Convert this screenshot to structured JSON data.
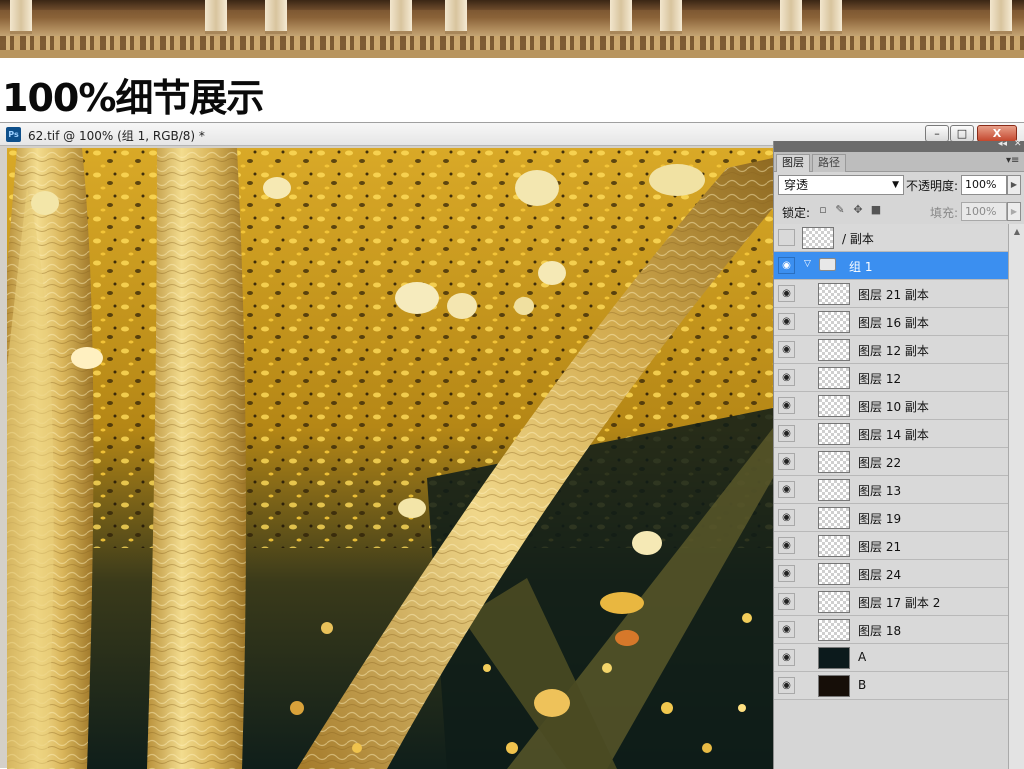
{
  "banner": {
    "headline": "100%细节展示"
  },
  "window": {
    "app_icon": "Ps",
    "title": "62.tif @ 100% (组 1, RGB/8) *",
    "min_label": "–",
    "max_label": "□",
    "close_label": "X"
  },
  "panel": {
    "tabs": [
      "图层",
      "路径"
    ],
    "menu_icon": "▾≡",
    "blend_mode": "穿透",
    "opacity_label": "不透明度:",
    "opacity_value": "100%",
    "lock_label": "锁定:",
    "fill_label": "填充:",
    "fill_value": "100%",
    "layers": [
      {
        "name": "/ 副本",
        "visible": false,
        "thumb": "checker"
      },
      {
        "name": "组 1",
        "visible": true,
        "type": "group",
        "selected": true
      },
      {
        "name": "图层 21 副本",
        "visible": true,
        "thumb": "checker"
      },
      {
        "name": "图层 16 副本",
        "visible": true,
        "thumb": "checker"
      },
      {
        "name": "图层 12 副本",
        "visible": true,
        "thumb": "checker"
      },
      {
        "name": "图层 12",
        "visible": true,
        "thumb": "checker"
      },
      {
        "name": "图层 10 副本",
        "visible": true,
        "thumb": "checker"
      },
      {
        "name": "图层 14 副本",
        "visible": true,
        "thumb": "checker"
      },
      {
        "name": "图层 22",
        "visible": true,
        "thumb": "checker"
      },
      {
        "name": "图层 13",
        "visible": true,
        "thumb": "checker"
      },
      {
        "name": "图层 19",
        "visible": true,
        "thumb": "checker"
      },
      {
        "name": "图层 21",
        "visible": true,
        "thumb": "checker"
      },
      {
        "name": "图层 24",
        "visible": true,
        "thumb": "checker"
      },
      {
        "name": "图层 17 副本 2",
        "visible": true,
        "thumb": "checker"
      },
      {
        "name": "图层 18",
        "visible": true,
        "thumb": "checker"
      },
      {
        "name": "A",
        "visible": true,
        "thumb": "dark"
      },
      {
        "name": "B",
        "visible": true,
        "thumb": "dark2"
      }
    ]
  },
  "colors": {
    "selection": "#3b8ff0",
    "gold": "#d8b44a",
    "dark_bg": "#0f1a16"
  },
  "icons": {
    "eye": "eye-icon",
    "folder": "folder-icon",
    "lock_transparent": "lock-transparent-icon",
    "lock_brush": "lock-brush-icon",
    "lock_move": "lock-move-icon",
    "lock_all": "lock-all-icon"
  }
}
